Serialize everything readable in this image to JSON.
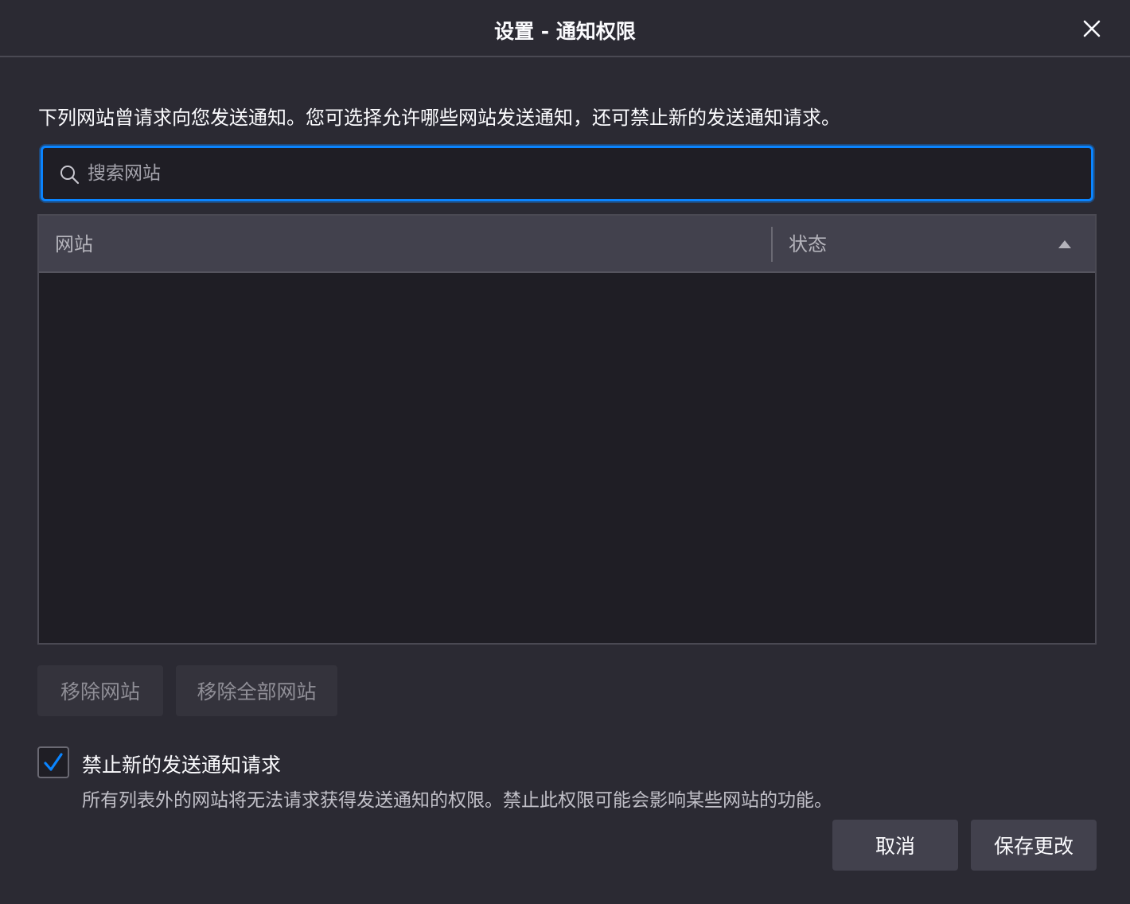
{
  "window": {
    "title": "设置 - 通知权限"
  },
  "description": "下列网站曾请求向您发送通知。您可选择允许哪些网站发送通知，还可禁止新的发送通知请求。",
  "search": {
    "placeholder": "搜索网站",
    "value": ""
  },
  "table": {
    "columns": [
      {
        "label": "网站"
      },
      {
        "label": "状态",
        "sort": "ascending"
      }
    ],
    "rows": []
  },
  "buttons": {
    "remove_site": "移除网站",
    "remove_all": "移除全部网站",
    "cancel": "取消",
    "save": "保存更改"
  },
  "block_requests": {
    "checked": true,
    "label": "禁止新的发送通知请求",
    "description": "所有列表外的网站将无法请求获得发送通知的权限。禁止此权限可能会影响某些网站的功能。"
  },
  "icons": {
    "close": "close-icon",
    "search": "search-icon",
    "sort": "sort-ascending-icon",
    "check": "checkmark-icon"
  },
  "colors": {
    "background": "#2b2a33",
    "accent": "#0a84ff",
    "check": "#0a84ff",
    "text": "#fbfbfe"
  }
}
